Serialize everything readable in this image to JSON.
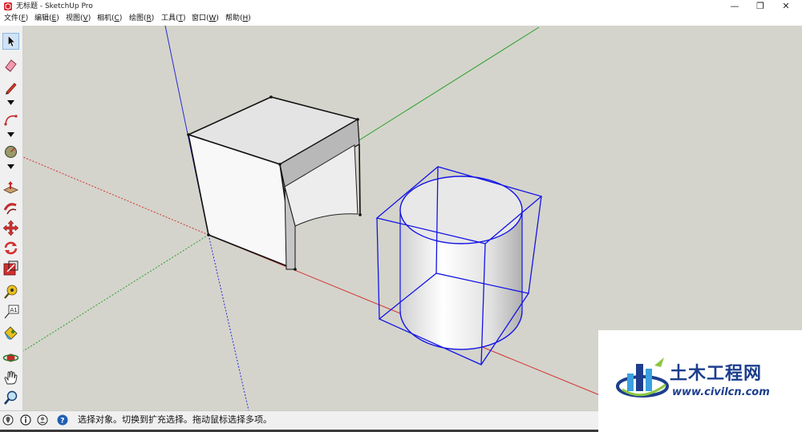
{
  "window": {
    "title": "无标题 - SketchUp Pro",
    "controls": {
      "minimize": "—",
      "maximize": "❐",
      "close": "✕"
    }
  },
  "menu": {
    "items": [
      {
        "label": "文件(",
        "key": "F",
        "suffix": ")"
      },
      {
        "label": "编辑(",
        "key": "E",
        "suffix": ")"
      },
      {
        "label": "视图(",
        "key": "V",
        "suffix": ")"
      },
      {
        "label": "相机(",
        "key": "C",
        "suffix": ")"
      },
      {
        "label": "绘图(",
        "key": "R",
        "suffix": ")"
      },
      {
        "label": "工具(",
        "key": "T",
        "suffix": ")"
      },
      {
        "label": "窗口(",
        "key": "W",
        "suffix": ")"
      },
      {
        "label": "帮助(",
        "key": "H",
        "suffix": ")"
      }
    ]
  },
  "toolbar": {
    "tools": [
      "select-tool",
      "eraser-tool",
      "pencil-line-tool",
      "arc-tool",
      "shape-tool",
      "push-pull-tool",
      "follow-me-tool",
      "move-tool",
      "rotate-tool",
      "scale-tool",
      "tape-measure-tool",
      "text-tool",
      "paint-bucket-tool",
      "orbit-tool",
      "pan-tool",
      "zoom-tool"
    ],
    "selected": "select-tool"
  },
  "status": {
    "text": "选择对象。切换到扩充选择。拖动鼠标选择多项。"
  },
  "watermark": {
    "brand": "土木工程网",
    "url": "www.civilcn.com"
  },
  "colors": {
    "viewport_bg": "#d4d4cc",
    "axis_red": "#d43030",
    "axis_green": "#2aa02a",
    "axis_blue": "#2a2ad8",
    "selection_blue": "#1414e6",
    "brand_blue": "#1c3e8c"
  }
}
